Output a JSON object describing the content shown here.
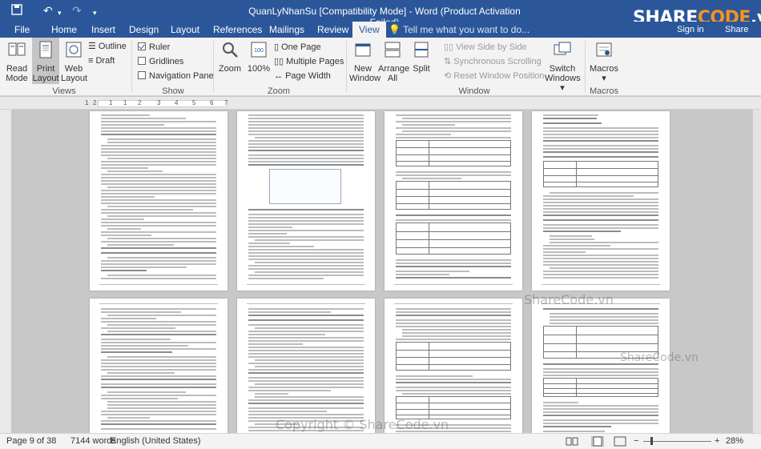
{
  "window": {
    "title": "QuanLyNhanSu [Compatibility Mode] - Word (Product Activation Failed)",
    "logo_text_a": "SHARE",
    "logo_text_b": "CODE",
    "logo_text_c": ".vn",
    "sign_in": "Sign in",
    "share": "Share",
    "tell_me": "Tell me what you want to do..."
  },
  "tabs": [
    {
      "label": "File"
    },
    {
      "label": "Home"
    },
    {
      "label": "Insert"
    },
    {
      "label": "Design"
    },
    {
      "label": "Layout"
    },
    {
      "label": "References"
    },
    {
      "label": "Mailings"
    },
    {
      "label": "Review"
    },
    {
      "label": "View",
      "active": true
    }
  ],
  "ribbon": {
    "views": {
      "group": "Views",
      "read_mode_1": "Read",
      "read_mode_2": "Mode",
      "print_layout_1": "Print",
      "print_layout_2": "Layout",
      "web_layout_1": "Web",
      "web_layout_2": "Layout",
      "outline": "Outline",
      "draft": "Draft"
    },
    "show": {
      "group": "Show",
      "ruler": "Ruler",
      "gridlines": "Gridlines",
      "navigation_pane": "Navigation Pane",
      "ruler_checked": true,
      "gridlines_checked": false,
      "navigation_checked": false
    },
    "zoom": {
      "group": "Zoom",
      "zoom": "Zoom",
      "hundred": "100%",
      "one_page": "One Page",
      "multiple_pages": "Multiple Pages",
      "page_width": "Page Width"
    },
    "window": {
      "group": "Window",
      "new_window_1": "New",
      "new_window_2": "Window",
      "arrange_all_1": "Arrange",
      "arrange_all_2": "All",
      "split": "Split",
      "view_side": "View Side by Side",
      "sync_scroll": "Synchronous Scrolling",
      "reset_window": "Reset Window Position",
      "switch_1": "Switch",
      "switch_2": "Windows"
    },
    "macros": {
      "group": "Macros",
      "label": "Macros"
    }
  },
  "ruler": {
    "ticks": [
      "1",
      "2",
      "1",
      "1",
      "2",
      "3",
      "4",
      "5",
      "6",
      "7"
    ]
  },
  "status": {
    "page": "Page 9 of 38",
    "words": "7144 words",
    "language": "English (United States)",
    "zoom": "28%",
    "zoom_level": 0.28
  },
  "watermarks": [
    "ShareCode.vn",
    "ShareCode.vn",
    "Copyright © ShareCode.vn"
  ],
  "colors": {
    "accent": "#2b579a",
    "brand_orange": "#f7941d",
    "ribbon": "#f3f3f3"
  }
}
